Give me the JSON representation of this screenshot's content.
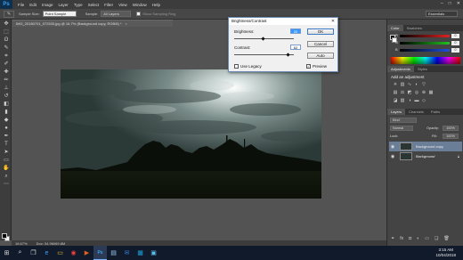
{
  "menubar": {
    "logo": "Ps",
    "items": [
      "File",
      "Edit",
      "Image",
      "Layer",
      "Type",
      "Select",
      "Filter",
      "View",
      "Window",
      "Help"
    ],
    "window_controls": [
      "–",
      "□",
      "✕"
    ]
  },
  "options": {
    "tool_icon": "✎",
    "sample_size_label": "Sample Size:",
    "sample_size_value": "Point Sample",
    "sample_label": "Sample:",
    "sample_value": "All Layers",
    "show_ring_label": "Show Sampling Ring",
    "workspace": "Essentials"
  },
  "document": {
    "tab_label": "IMG_20180701_072533.jpg @ 16.7% (Background copy, RGB/8) *",
    "close": "×"
  },
  "status": {
    "zoom": "16.67%",
    "doc_size": "Doc: 34.9M/69.8M"
  },
  "panels": {
    "color_tabs": [
      "Color",
      "Swatches"
    ],
    "color_channels": [
      {
        "label": "R",
        "value": "0",
        "color": "#e02020"
      },
      {
        "label": "G",
        "value": "0",
        "color": "#20c020"
      },
      {
        "label": "B",
        "value": "0",
        "color": "#2050e0"
      }
    ],
    "adjust_tabs": [
      "Adjustments",
      "Styles"
    ],
    "adjust_title": "Add an adjustment",
    "layers_tabs": [
      "Layers",
      "Channels",
      "Paths"
    ],
    "layers_kind": "Kind",
    "layers_blend": "Normal",
    "layers_opacity_label": "Opacity:",
    "layers_opacity": "100%",
    "layers_lock_label": "Lock:",
    "layers_fill_label": "Fill:",
    "layers_fill": "100%",
    "layers": [
      {
        "name": "Background copy",
        "selected": true
      },
      {
        "name": "Background",
        "selected": false
      }
    ]
  },
  "dialog": {
    "title": "Brightness/Contrast",
    "close": "✕",
    "brightness_label": "Brightness:",
    "brightness_value": "20",
    "contrast_label": "Contrast:",
    "contrast_value": "62",
    "ok_label": "OK",
    "cancel_label": "Cancel",
    "auto_label": "Auto",
    "preview_label": "Preview",
    "preview_checked": "✓",
    "legacy_label": "Use Legacy"
  },
  "taskbar": {
    "icons": [
      {
        "name": "start-icon",
        "glyph": "⊞"
      },
      {
        "name": "search-icon",
        "glyph": "⌕"
      },
      {
        "name": "task-view-icon",
        "glyph": "❐"
      },
      {
        "name": "edge-icon",
        "glyph": "e"
      },
      {
        "name": "explorer-icon",
        "glyph": "▭"
      },
      {
        "name": "chrome-icon",
        "glyph": "◉"
      },
      {
        "name": "media-icon",
        "glyph": "▶"
      },
      {
        "name": "photoshop-icon",
        "glyph": "Ps"
      },
      {
        "name": "store-icon",
        "glyph": "▤"
      },
      {
        "name": "mail-icon",
        "glyph": "✉"
      },
      {
        "name": "app-icon",
        "glyph": "▦"
      },
      {
        "name": "photos-icon",
        "glyph": "▣"
      }
    ],
    "time": "3:15 AM",
    "date": "10/04/2018"
  }
}
